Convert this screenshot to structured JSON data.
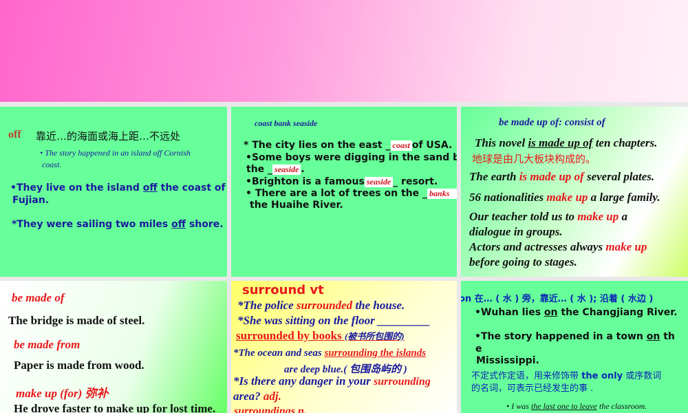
{
  "panel_off": {
    "word": "off",
    "meaning": "靠近…的海面或海上距…不远处",
    "ex1": "The story happened in an island off Cornish",
    "ex1b": "coast.",
    "ex2a": "They live on the island",
    "ex2u": "off",
    "ex2b": "the coast of",
    "ex2c": "Fujian.",
    "ex3a": "*They were sailing two miles",
    "ex3u": "off",
    "ex3b": "shore."
  },
  "panel_coast": {
    "words": "coast  bank  seaside",
    "l1a": "* The city lies on the east _",
    "a1": "coast",
    "l1b": "of USA.",
    "l2": "Some boys were digging in the sand by",
    "l3a": "the _",
    "a2": "seaside",
    "l3b": ".",
    "l4a": "Brighton is a famous",
    "a3": "seaside",
    "l4b": "_ resort.",
    "l5a": " There are a lot of trees on the _",
    "a4": "banks",
    "l6": "the Huaihe River."
  },
  "panel_made": {
    "title": "be made up of: consist of",
    "l1a": "This novel ",
    "l1u": "is made up of",
    "l1b": " ten chapters.",
    "l2": "地球是由几大板块构成的。",
    "l3a": "The earth ",
    "l3r": "is made up of",
    "l3b": " several plates.",
    "l4a": "56 nationalities ",
    "l4r": "make up",
    "l4b": " a large family.",
    "l5a": "Our teacher told us to ",
    "l5r": "make up",
    "l5b": " a",
    "l6": "dialogue in groups.",
    "l7a": "Actors and actresses always ",
    "l7r": "make up",
    "l8": "before going to stages."
  },
  "panel_madeof": {
    "h1": "be made of",
    "s1": "The bridge is made of steel.",
    "h2": "be made from",
    "s2": "Paper is made from wood.",
    "h3": "make up (for) 弥补",
    "s3": "He drove faster to make up for lost  time."
  },
  "panel_surround": {
    "title": "surround   vt",
    "l1a": "*The police ",
    "l1r": "surrounded",
    "l1b": " the house.",
    "l2": "*She was sitting on the floor _________",
    "l3r": "surrounded by books",
    "l3b": "(被书所包围的)",
    "l4a": "*The ocean and seas ",
    "l4r": "surrounding the islands",
    "l5": "are deep blue.( 包围岛屿的 )",
    "l6a": "*Is there any danger in your ",
    "l6r": "surrounding",
    "l7a": "area?   ",
    "l7r": "adj.",
    "l8": "surroundings  n."
  },
  "panel_on": {
    "title": "on  在… ( 水 ) 旁，靠近… ( 水 );  沿着 ( 水边 )",
    "l1a": "Wuhan lies ",
    "l1u": "on",
    "l1b": " the Changjiang River.",
    "l2a": "The story happened in a town ",
    "l2u": "on",
    "l2b": " th",
    "l3": "e",
    "l4": "Mississippi.",
    "l5a": "不定式作定语，用来修饰带 ",
    "l5b": "the only",
    "l5c": " 或序数词",
    "l6": "的名词，可表示已经发生的事 .",
    "l7a": "I was ",
    "l7u": "the last one to leave",
    "l7b": " the classroom."
  }
}
